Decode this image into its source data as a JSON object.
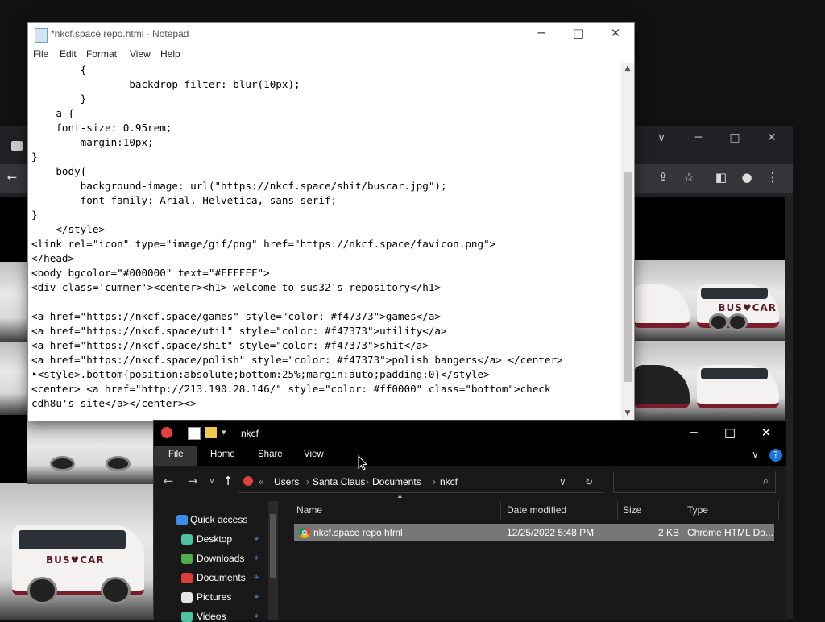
{
  "notepad": {
    "title": "*nkcf.space repo.html - Notepad",
    "menu": [
      "File",
      "Edit",
      "Format",
      "View",
      "Help"
    ],
    "lines": [
      "        {",
      "                backdrop-filter: blur(10px);",
      "        }",
      "    a {",
      "    font-size: 0.95rem;",
      "        margin:10px;",
      "}",
      "    body{",
      "        background-image: url(\"https://nkcf.space/shit/buscar.jpg\");",
      "        font-family: Arial, Helvetica, sans-serif;",
      "}",
      "    </style>",
      "<link rel=\"icon\" type=\"image/gif/png\" href=\"https://nkcf.space/favicon.png\">",
      "</head>",
      "<body bgcolor=\"#000000\" text=\"#FFFFFF\">",
      "<div class='cummer'><center><h1> welcome to sus32's repository</h1>",
      "",
      "<a href=\"https://nkcf.space/games\" style=\"color: #f47373\">games</a>",
      "<a href=\"https://nkcf.space/util\" style=\"color: #f47373\">utility</a>",
      "<a href=\"https://nkcf.space/shit\" style=\"color: #f47373\">shit</a>",
      "<a href=\"https://nkcf.space/polish\" style=\"color: #f47373\">polish bangers</a> </center>",
      "‣<style>.bottom{position:absolute;bottom:25%;margin:auto;padding:0}</style>",
      "<center> <a href=\"http://213.190.28.146/\" style=\"color: #ff0000\" class=\"bottom\">check",
      "cdh8u's site</a></center><>"
    ]
  },
  "explorer": {
    "title": "nkcf",
    "ribbon_tabs": [
      "File",
      "Home",
      "Share",
      "View"
    ],
    "help": "?",
    "address": {
      "prefix": "«",
      "crumbs": [
        "Users",
        "Santa Claus",
        "Documents",
        "nkcf"
      ]
    },
    "sidebar": [
      {
        "label": "Quick access",
        "icon": "star-icon",
        "color": "#3c8ee8",
        "pinned": false
      },
      {
        "label": "Desktop",
        "icon": "desktop-folder-icon",
        "color": "#4fc3a1",
        "pinned": true
      },
      {
        "label": "Downloads",
        "icon": "downloads-folder-icon",
        "color": "#4fae4a",
        "pinned": true
      },
      {
        "label": "Documents",
        "icon": "documents-folder-icon",
        "color": "#d9403a",
        "pinned": true
      },
      {
        "label": "Pictures",
        "icon": "pictures-folder-icon",
        "color": "#e6e6e6",
        "pinned": true
      },
      {
        "label": "Videos",
        "icon": "videos-folder-icon",
        "color": "#4fc3a1",
        "pinned": true
      }
    ],
    "columns": [
      "Name",
      "Date modified",
      "Size",
      "Type"
    ],
    "files": [
      {
        "name": "nkcf.space repo.html",
        "date": "12/25/2022 5:48 PM",
        "size": "2 KB",
        "type": "Chrome HTML Do..."
      }
    ]
  },
  "chrome": {
    "logo_text": "BUS♥CAR"
  }
}
